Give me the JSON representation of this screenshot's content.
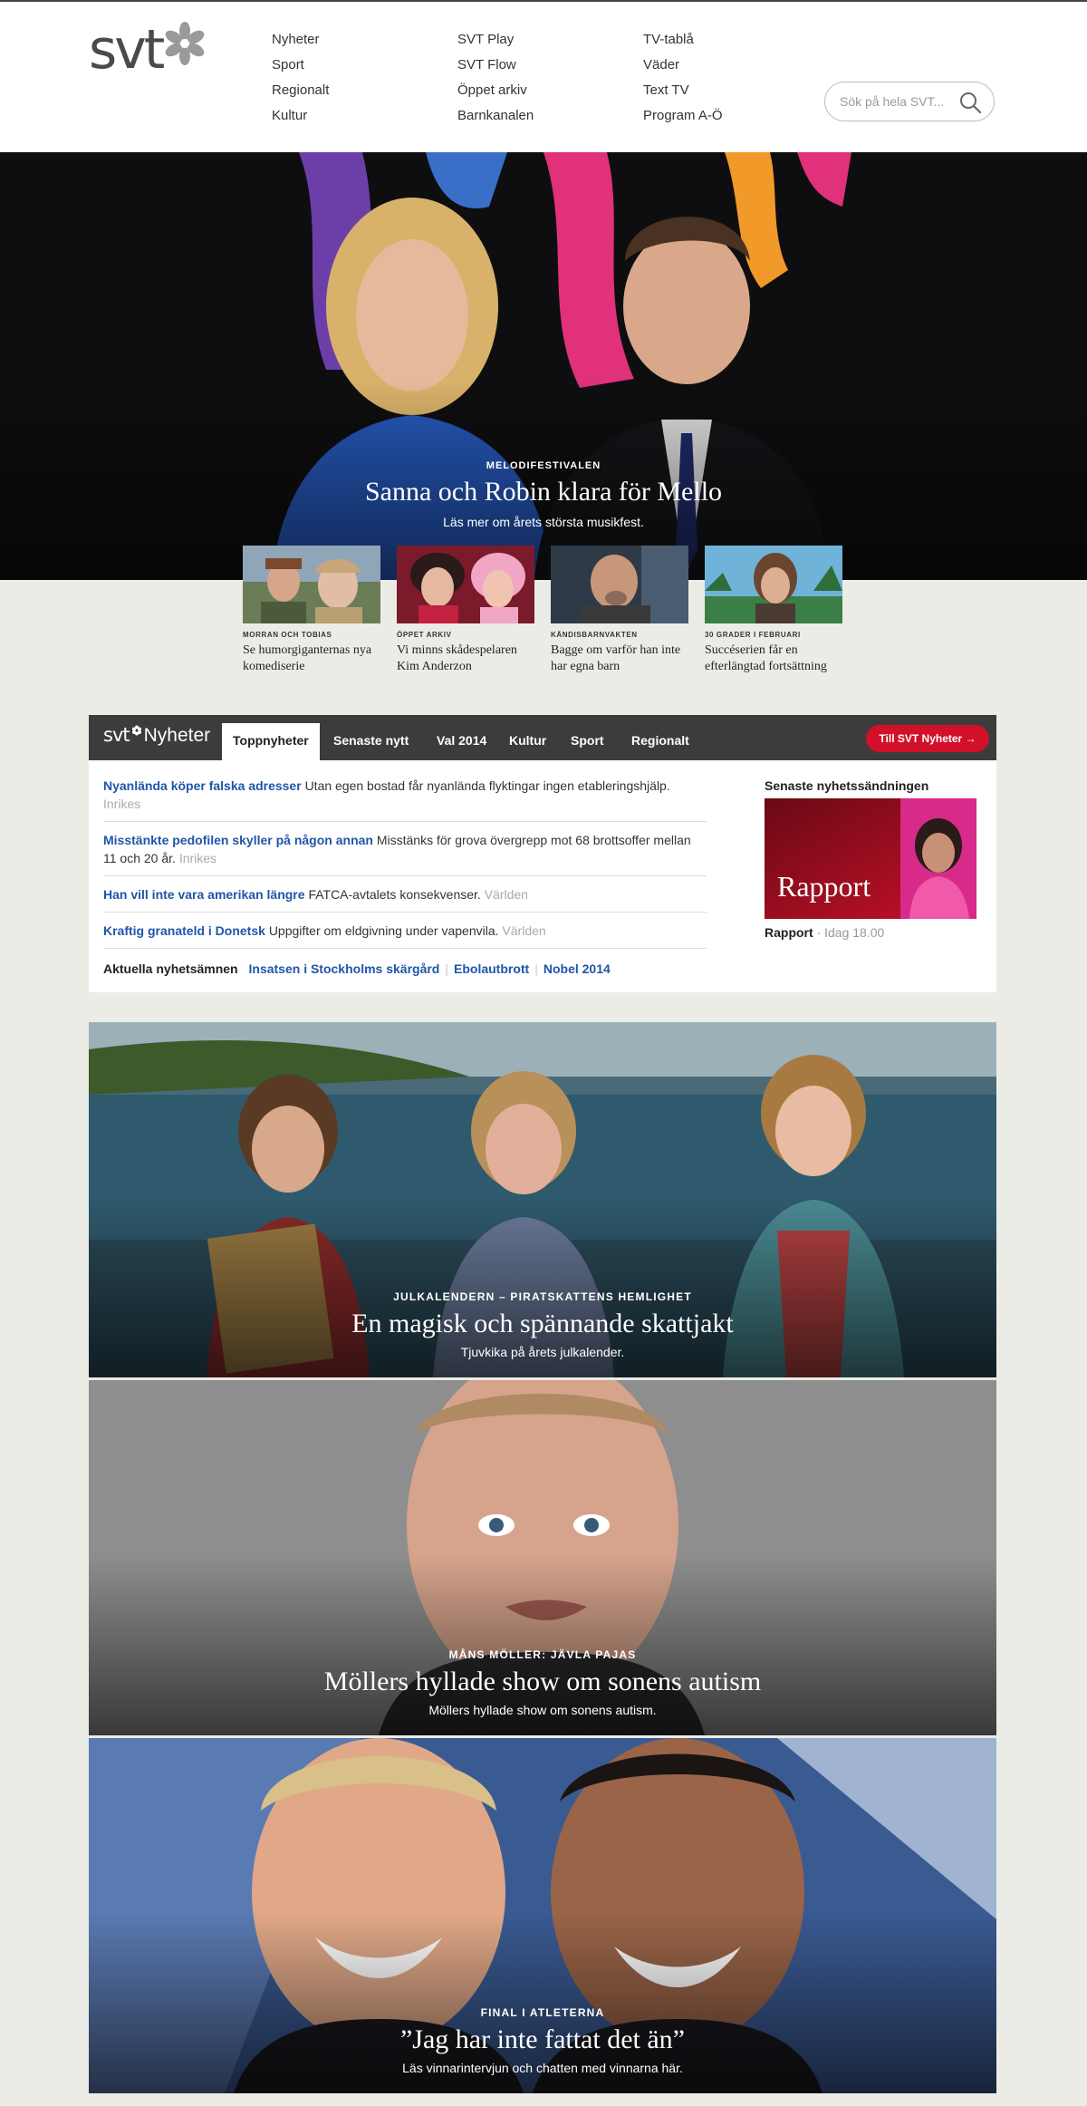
{
  "header": {
    "logo_text": "svt",
    "nav_columns": [
      [
        "Nyheter",
        "Sport",
        "Regionalt",
        "Kultur"
      ],
      [
        "SVT Play",
        "SVT Flow",
        "Öppet arkiv",
        "Barnkanalen"
      ],
      [
        "TV-tablå",
        "Väder",
        "Text TV",
        "Program A-Ö"
      ]
    ],
    "search_placeholder": "Sök på hela SVT..."
  },
  "hero": {
    "eyebrow": "MELODIFESTIVALEN",
    "title": "Sanna och Robin klara för Mello",
    "subtitle": "Läs mer om årets största musikfest."
  },
  "teasers": [
    {
      "category": "MORRAN OCH TOBIAS",
      "title": "Se humorgiganternas nya komediserie"
    },
    {
      "category": "ÖPPET ARKIV",
      "title": "Vi minns skådespelaren Kim Anderzon"
    },
    {
      "category": "KÄNDISBARNVAKTEN",
      "title": "Bagge om varför han inte har egna barn"
    },
    {
      "category": "30 GRADER I FEBRUARI",
      "title": "Succéserien får en efterlängtad fortsättning"
    }
  ],
  "news": {
    "logo_svt": "svt",
    "logo_name": "Nyheter",
    "tabs": [
      "Toppnyheter",
      "Senaste nytt",
      "Val 2014",
      "Kultur",
      "Sport",
      "Regionalt"
    ],
    "cta": "Till SVT Nyheter",
    "stories": [
      {
        "headline": "Nyanlända köper falska adresser",
        "text": "Utan egen bostad får nyanlända flyktingar ingen etableringshjälp.",
        "tag": "Inrikes"
      },
      {
        "headline": "Misstänkte pedofilen skyller på någon annan",
        "text": "Misstänks för grova övergrepp mot 68 brottsoffer mellan 11 och 20 år.",
        "tag": "Inrikes"
      },
      {
        "headline": "Han vill inte vara amerikan längre",
        "text": "FATCA-avtalets konsekvenser.",
        "tag": "Världen"
      },
      {
        "headline": "Kraftig granateld i Donetsk",
        "text": "Uppgifter om eldgivning under vapenvila.",
        "tag": "Världen"
      }
    ],
    "topics_label": "Aktuella nyhetsämnen",
    "topics": [
      "Insatsen i Stockholms skärgård",
      "Ebolautbrott",
      "Nobel 2014"
    ],
    "latest_title": "Senaste nyhetssändningen",
    "latest_image_text": "Rapport",
    "latest_program": "Rapport",
    "latest_time": "Idag 18.00"
  },
  "features": [
    {
      "eyebrow": "JULKALENDERN – PIRATSKATTENS HEMLIGHET",
      "title": "En magisk och spännande skattjakt",
      "subtitle": "Tjuvkika på årets julkalender."
    },
    {
      "eyebrow": "MÅNS MÖLLER: JÄVLA PAJAS",
      "title": "Möllers hyllade show om sonens autism",
      "subtitle": "Möllers hyllade show om sonens autism."
    },
    {
      "eyebrow": "FINAL I ATLETERNA",
      "title": "”Jag har inte fattat det än”",
      "subtitle": "Läs vinnarintervjun och chatten med vinnarna här."
    }
  ]
}
